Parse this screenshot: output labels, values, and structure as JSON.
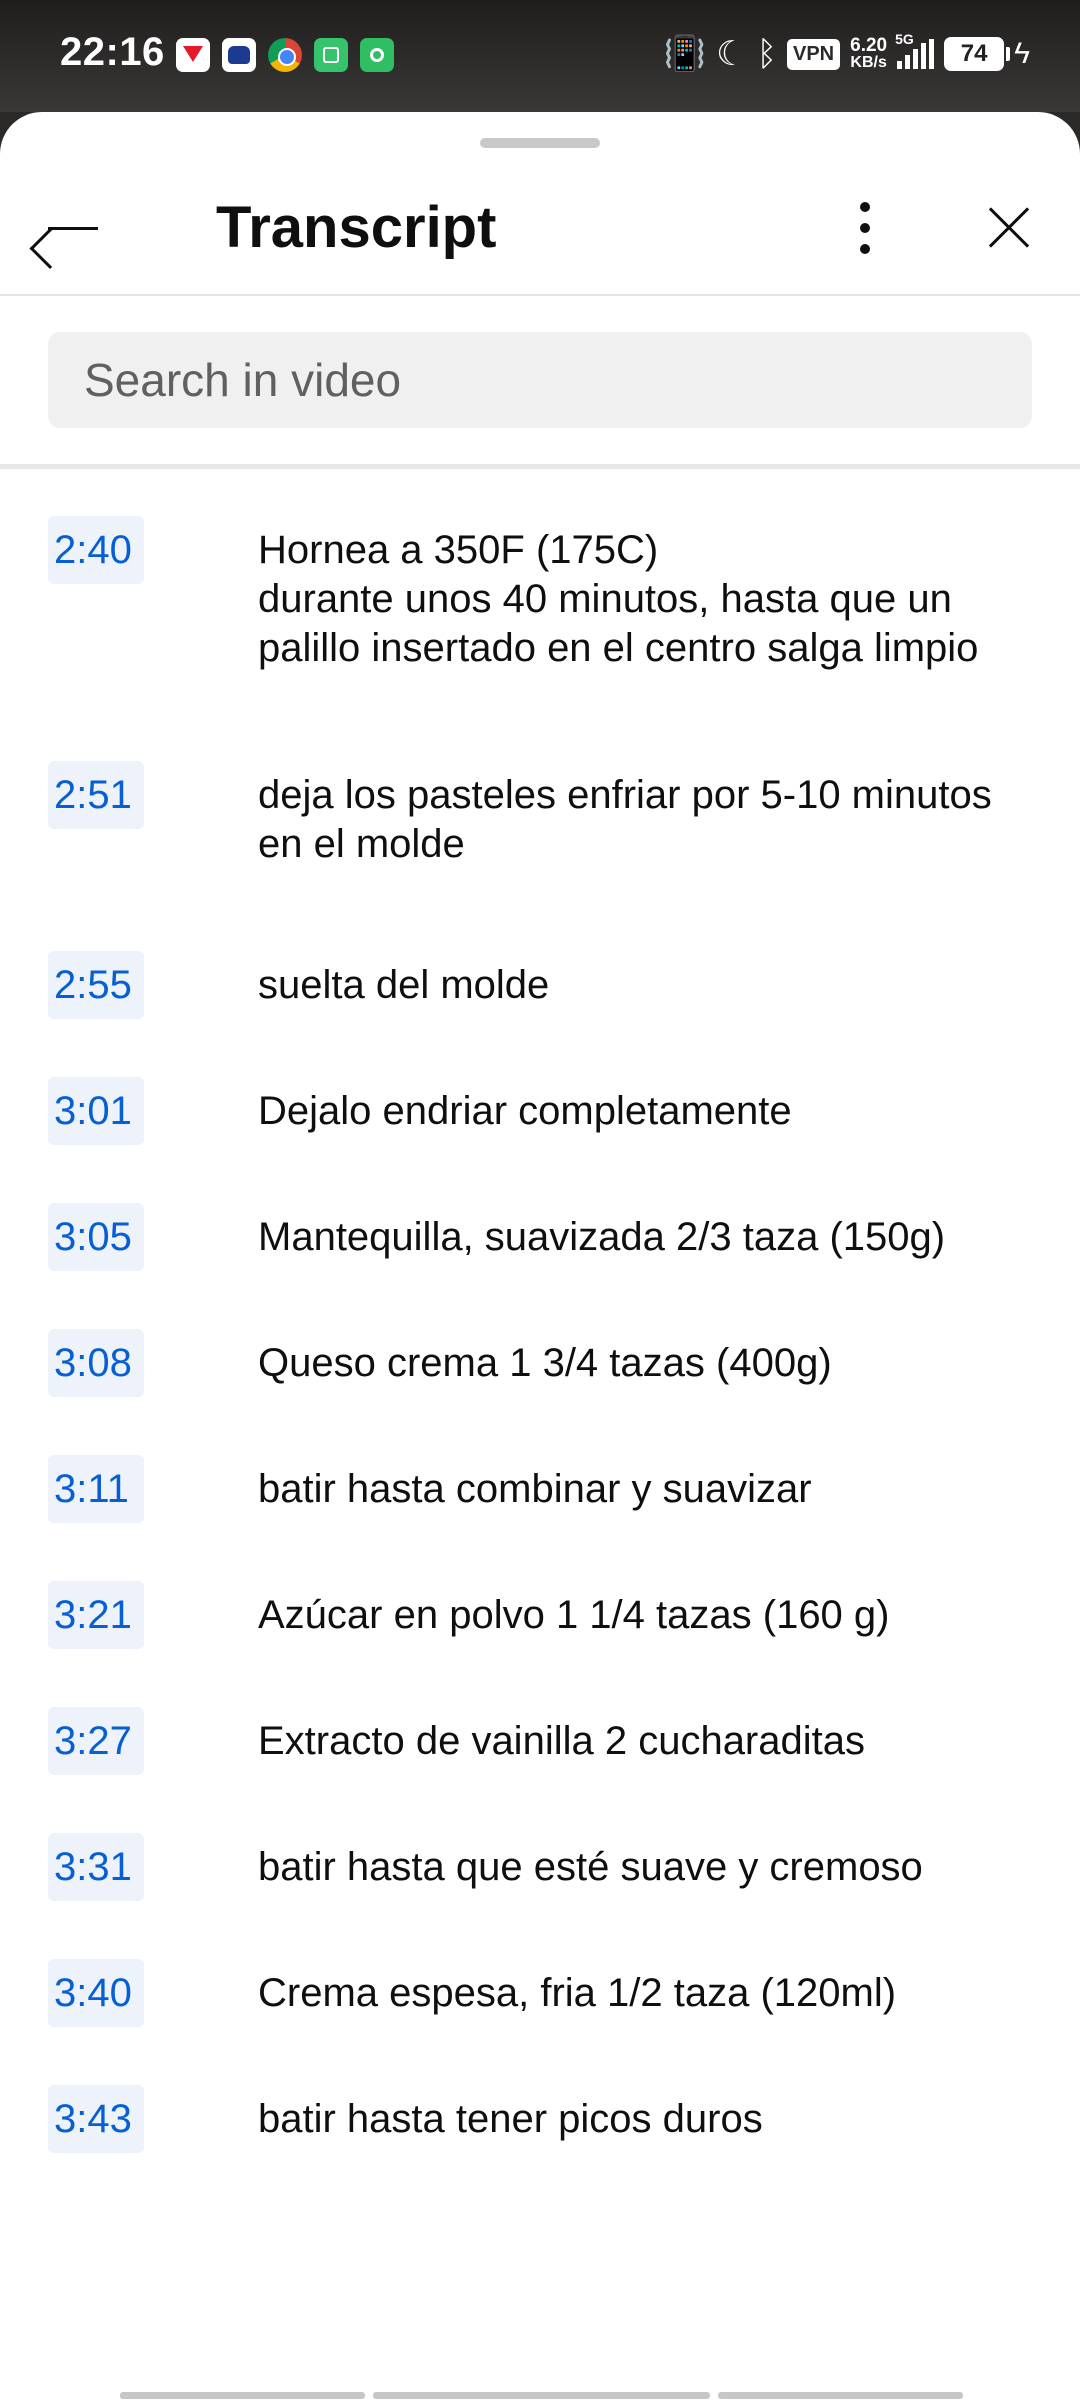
{
  "status_bar": {
    "time": "22:16",
    "vpn": "VPN",
    "net_speed_value": "6.20",
    "net_speed_unit": "KB/s",
    "network": "5G",
    "battery": "74"
  },
  "header": {
    "title": "Transcript"
  },
  "search": {
    "placeholder": "Search in video"
  },
  "segments": [
    {
      "time": "2:40",
      "text": "Hornea a 350F (175C)\ndurante unos 40 minutos, hasta que un palillo insertado en el centro salga limpio"
    },
    {
      "time": "2:51",
      "text": "deja los pasteles enfriar por 5-10 minutos en el molde"
    },
    {
      "time": "2:55",
      "text": "suelta del molde"
    },
    {
      "time": "3:01",
      "text": "Dejalo endriar completamente"
    },
    {
      "time": "3:05",
      "text": "Mantequilla, suavizada 2/3 taza (150g)"
    },
    {
      "time": "3:08",
      "text": "Queso crema 1 3/4 tazas (400g)"
    },
    {
      "time": "3:11",
      "text": "batir hasta combinar y suavizar"
    },
    {
      "time": "3:21",
      "text": "Azúcar en polvo 1 1/4 tazas (160 g)"
    },
    {
      "time": "3:27",
      "text": "Extracto de vainilla 2 cucharaditas"
    },
    {
      "time": "3:31",
      "text": "batir hasta que esté suave y cremoso"
    },
    {
      "time": "3:40",
      "text": "Crema espesa, fria 1/2 taza (120ml)"
    },
    {
      "time": "3:43",
      "text": "batir hasta tener picos duros"
    }
  ],
  "colors": {
    "timestamp": "#065fd4",
    "timestamp_bg": "#eef3fb"
  }
}
